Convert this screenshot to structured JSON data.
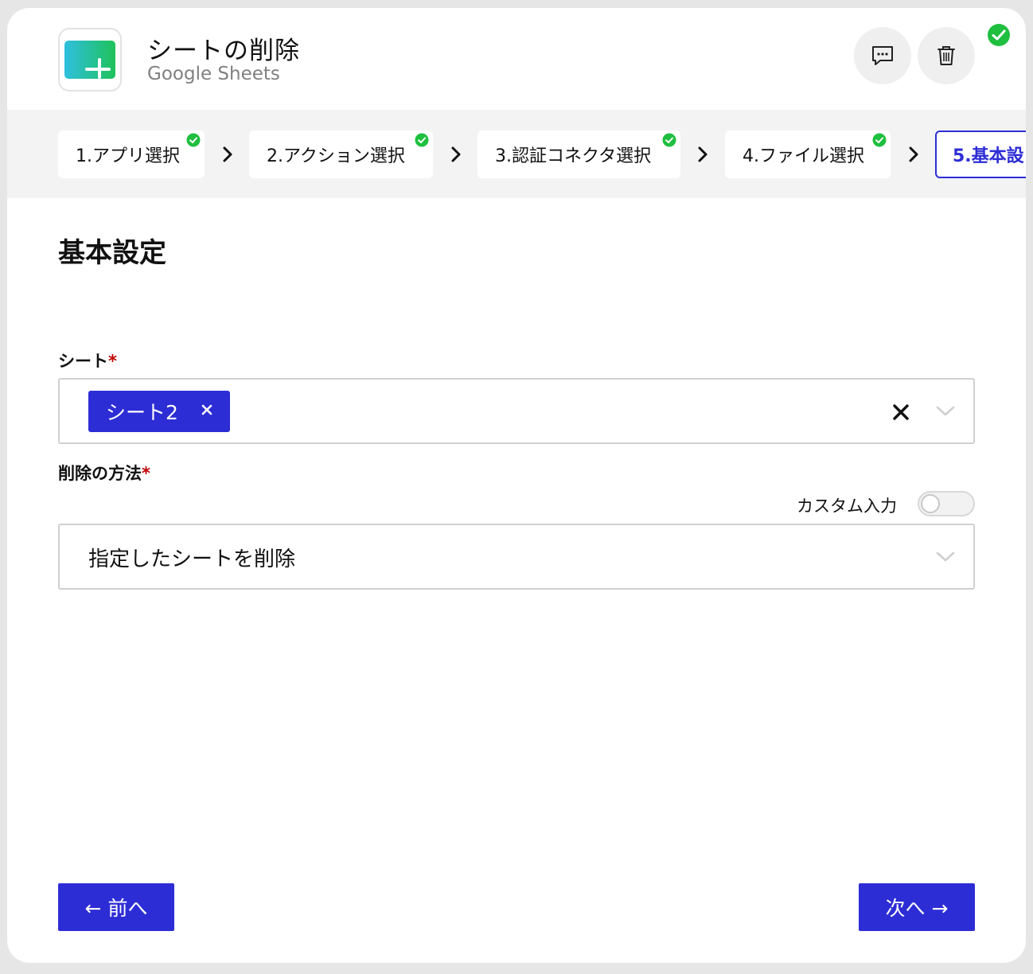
{
  "header": {
    "title": "シートの削除",
    "subtitle": "Google Sheets",
    "app_icon": "google-sheets-icon",
    "actions": [
      "comment-icon",
      "trash-icon"
    ],
    "status": "success-check-icon"
  },
  "stepper": {
    "steps": [
      {
        "label": "1.アプリ選択",
        "completed": true
      },
      {
        "label": "2.アクション選択",
        "completed": true
      },
      {
        "label": "3.認証コネクタ選択",
        "completed": true
      },
      {
        "label": "4.ファイル選択",
        "completed": true
      },
      {
        "label": "5.基本設",
        "completed": false,
        "active": true
      }
    ]
  },
  "main": {
    "section_title": "基本設定",
    "sheet_field": {
      "label": "シート",
      "required_mark": "*",
      "selected_tag": "シート2",
      "tag_remove_icon": "close-icon",
      "clear_icon": "close-icon",
      "dropdown_icon": "chevron-down-icon"
    },
    "method_field": {
      "label": "削除の方法",
      "required_mark": "*",
      "custom_input_label": "カスタム入力",
      "custom_input_enabled": false,
      "value": "指定したシートを削除",
      "dropdown_icon": "chevron-down-icon"
    }
  },
  "footer": {
    "prev_label": "← 前へ",
    "next_label": "次へ →"
  },
  "colors": {
    "accent": "#2d2dd6",
    "success": "#1fbf3f",
    "required": "#c00000"
  }
}
